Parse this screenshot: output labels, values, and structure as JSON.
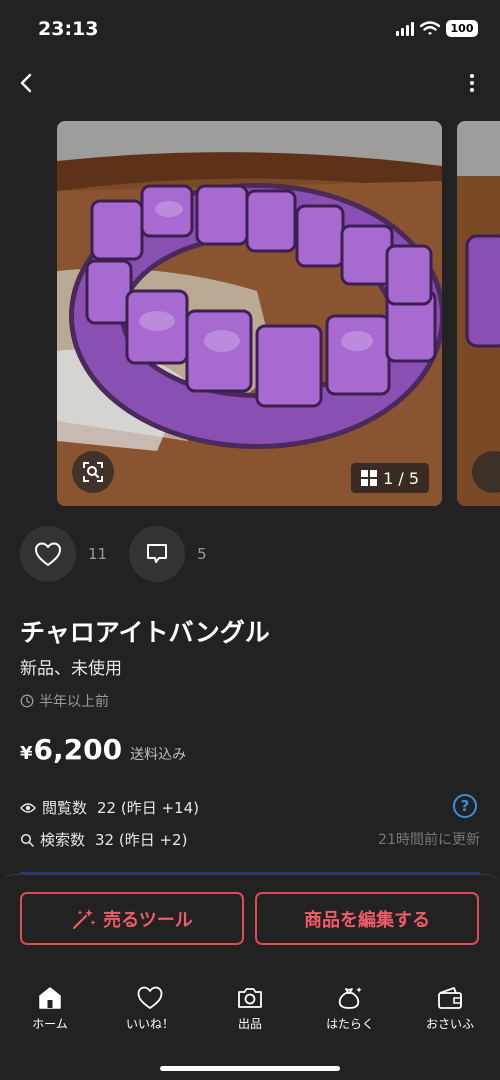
{
  "status_bar": {
    "time": "23:13",
    "battery": "100"
  },
  "gallery": {
    "counter": "1 / 5",
    "image_alt": "purple bracelet photo"
  },
  "social": {
    "likes": "11",
    "comments": "5"
  },
  "item": {
    "title": "チャロアイトバングル",
    "condition": "新品、未使用",
    "posted": "半年以上前",
    "currency": "¥",
    "price": "6,200",
    "shipping": "送料込み"
  },
  "stats": {
    "views_label": "閲覧数",
    "views_value": "22 (昨日 +14)",
    "searches_label": "検索数",
    "searches_value": "32 (昨日 +2)",
    "updated": "21時間前に更新",
    "help": "?"
  },
  "actions": {
    "sell_tool": "売るツール",
    "edit_item": "商品を編集する"
  },
  "tabs": [
    {
      "label": "ホーム",
      "icon": "home-icon"
    },
    {
      "label": "いいね！",
      "icon": "heart-icon"
    },
    {
      "label": "出品",
      "icon": "camera-icon"
    },
    {
      "label": "はたらく",
      "icon": "money-bag-icon"
    },
    {
      "label": "おさいふ",
      "icon": "wallet-icon"
    }
  ],
  "colors": {
    "background": "#222222",
    "accent": "#e04a55",
    "link": "#3a8fe0"
  }
}
